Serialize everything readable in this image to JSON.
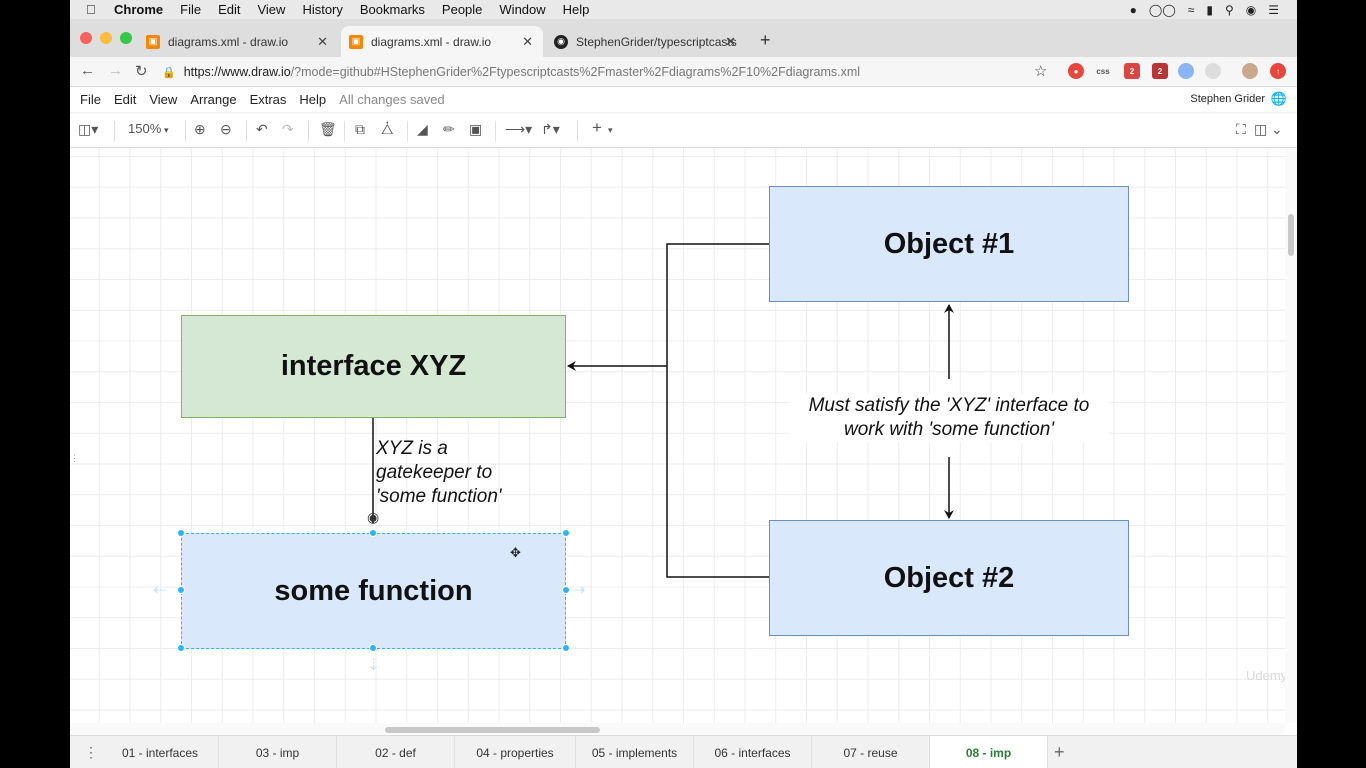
{
  "menubar": {
    "app": "Chrome",
    "items": [
      "File",
      "Edit",
      "View",
      "History",
      "Bookmarks",
      "People",
      "Window",
      "Help"
    ]
  },
  "tabs": [
    {
      "title": "diagrams.xml - draw.io",
      "active": false
    },
    {
      "title": "diagrams.xml - draw.io",
      "active": true
    },
    {
      "title": "StephenGrider/typescriptcasts",
      "active": false
    }
  ],
  "address": {
    "host": "https://www.draw.io",
    "path": "/?mode=github#HStephenGrider%2Ftypescriptcasts%2Fmaster%2Fdiagrams%2F10%2Fdiagrams.xml"
  },
  "extensions": [
    "css",
    "2",
    "2"
  ],
  "appmenu": {
    "items": [
      "File",
      "Edit",
      "View",
      "Arrange",
      "Extras",
      "Help"
    ],
    "status": "All changes saved",
    "user": "Stephen Grider"
  },
  "toolbar": {
    "zoom": "150%"
  },
  "diagram": {
    "interface_box": "interface XYZ",
    "function_box": "some function",
    "object1_box": "Object #1",
    "object2_box": "Object #2",
    "gatekeeper_note_1": "XYZ is a",
    "gatekeeper_note_2": "gatekeeper to",
    "gatekeeper_note_3": "'some function'",
    "satisfy_note_1": "Must satisfy the 'XYZ' interface to",
    "satisfy_note_2": "work with 'some function'"
  },
  "pages": [
    "01 - interfaces",
    "03 - imp",
    "02 - def",
    "04 - properties",
    "05 - implements",
    "06 - interfaces",
    "07 - reuse",
    "08 - imp"
  ],
  "active_page": "08 - imp",
  "watermark": "Udemy",
  "colors": {
    "blue_fill": "#dae8fc",
    "blue_stroke": "#6c8ebf",
    "green_fill": "#d5e8d4",
    "green_stroke": "#82b366",
    "selection": "#29b6f2"
  }
}
